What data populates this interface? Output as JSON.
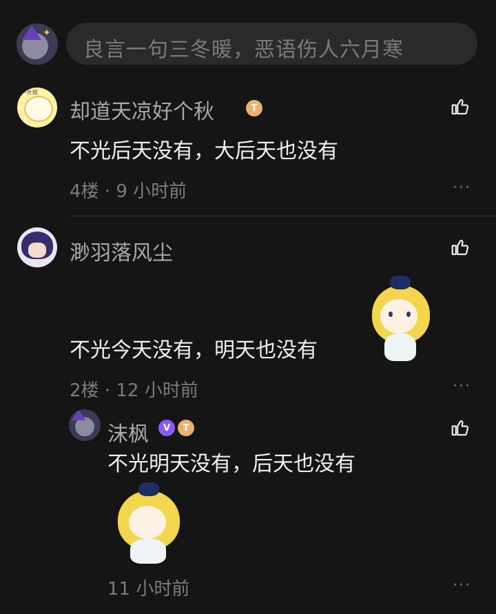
{
  "input": {
    "placeholder": "良言一句三冬暖，恶语伤人六月寒"
  },
  "comments": [
    {
      "name": "却道天凉好个秋",
      "badge": "T",
      "avatar_text": "一片辉",
      "text": "不光后天没有，大后天也没有",
      "floor": "4楼",
      "time": "9 小时前",
      "more": "···"
    },
    {
      "name": "渺羽落风尘",
      "text": "不光今天没有，明天也没有",
      "floor": "2楼",
      "time": "12 小时前",
      "more": "···",
      "sticker": "sticker-girl-blonde"
    }
  ],
  "reply": {
    "name": "沫枫",
    "badge_v": "V",
    "badge_t": "T",
    "text": "不光明天没有，后天也没有",
    "time": "11 小时前",
    "more": "···",
    "sticker": "sticker-girl-blonde-covering-face"
  },
  "meta_sep": "·",
  "icons": [
    "thumbs-up-icon",
    "more-dots-icon"
  ],
  "colors": {
    "background": "#151515",
    "input_bg": "#2a2a2a",
    "name": "#a9a9a9",
    "meta": "#7c7c7c",
    "text": "#f0f0f0",
    "vip": "#8a5cf5",
    "title_badge": "#e7b36e"
  }
}
